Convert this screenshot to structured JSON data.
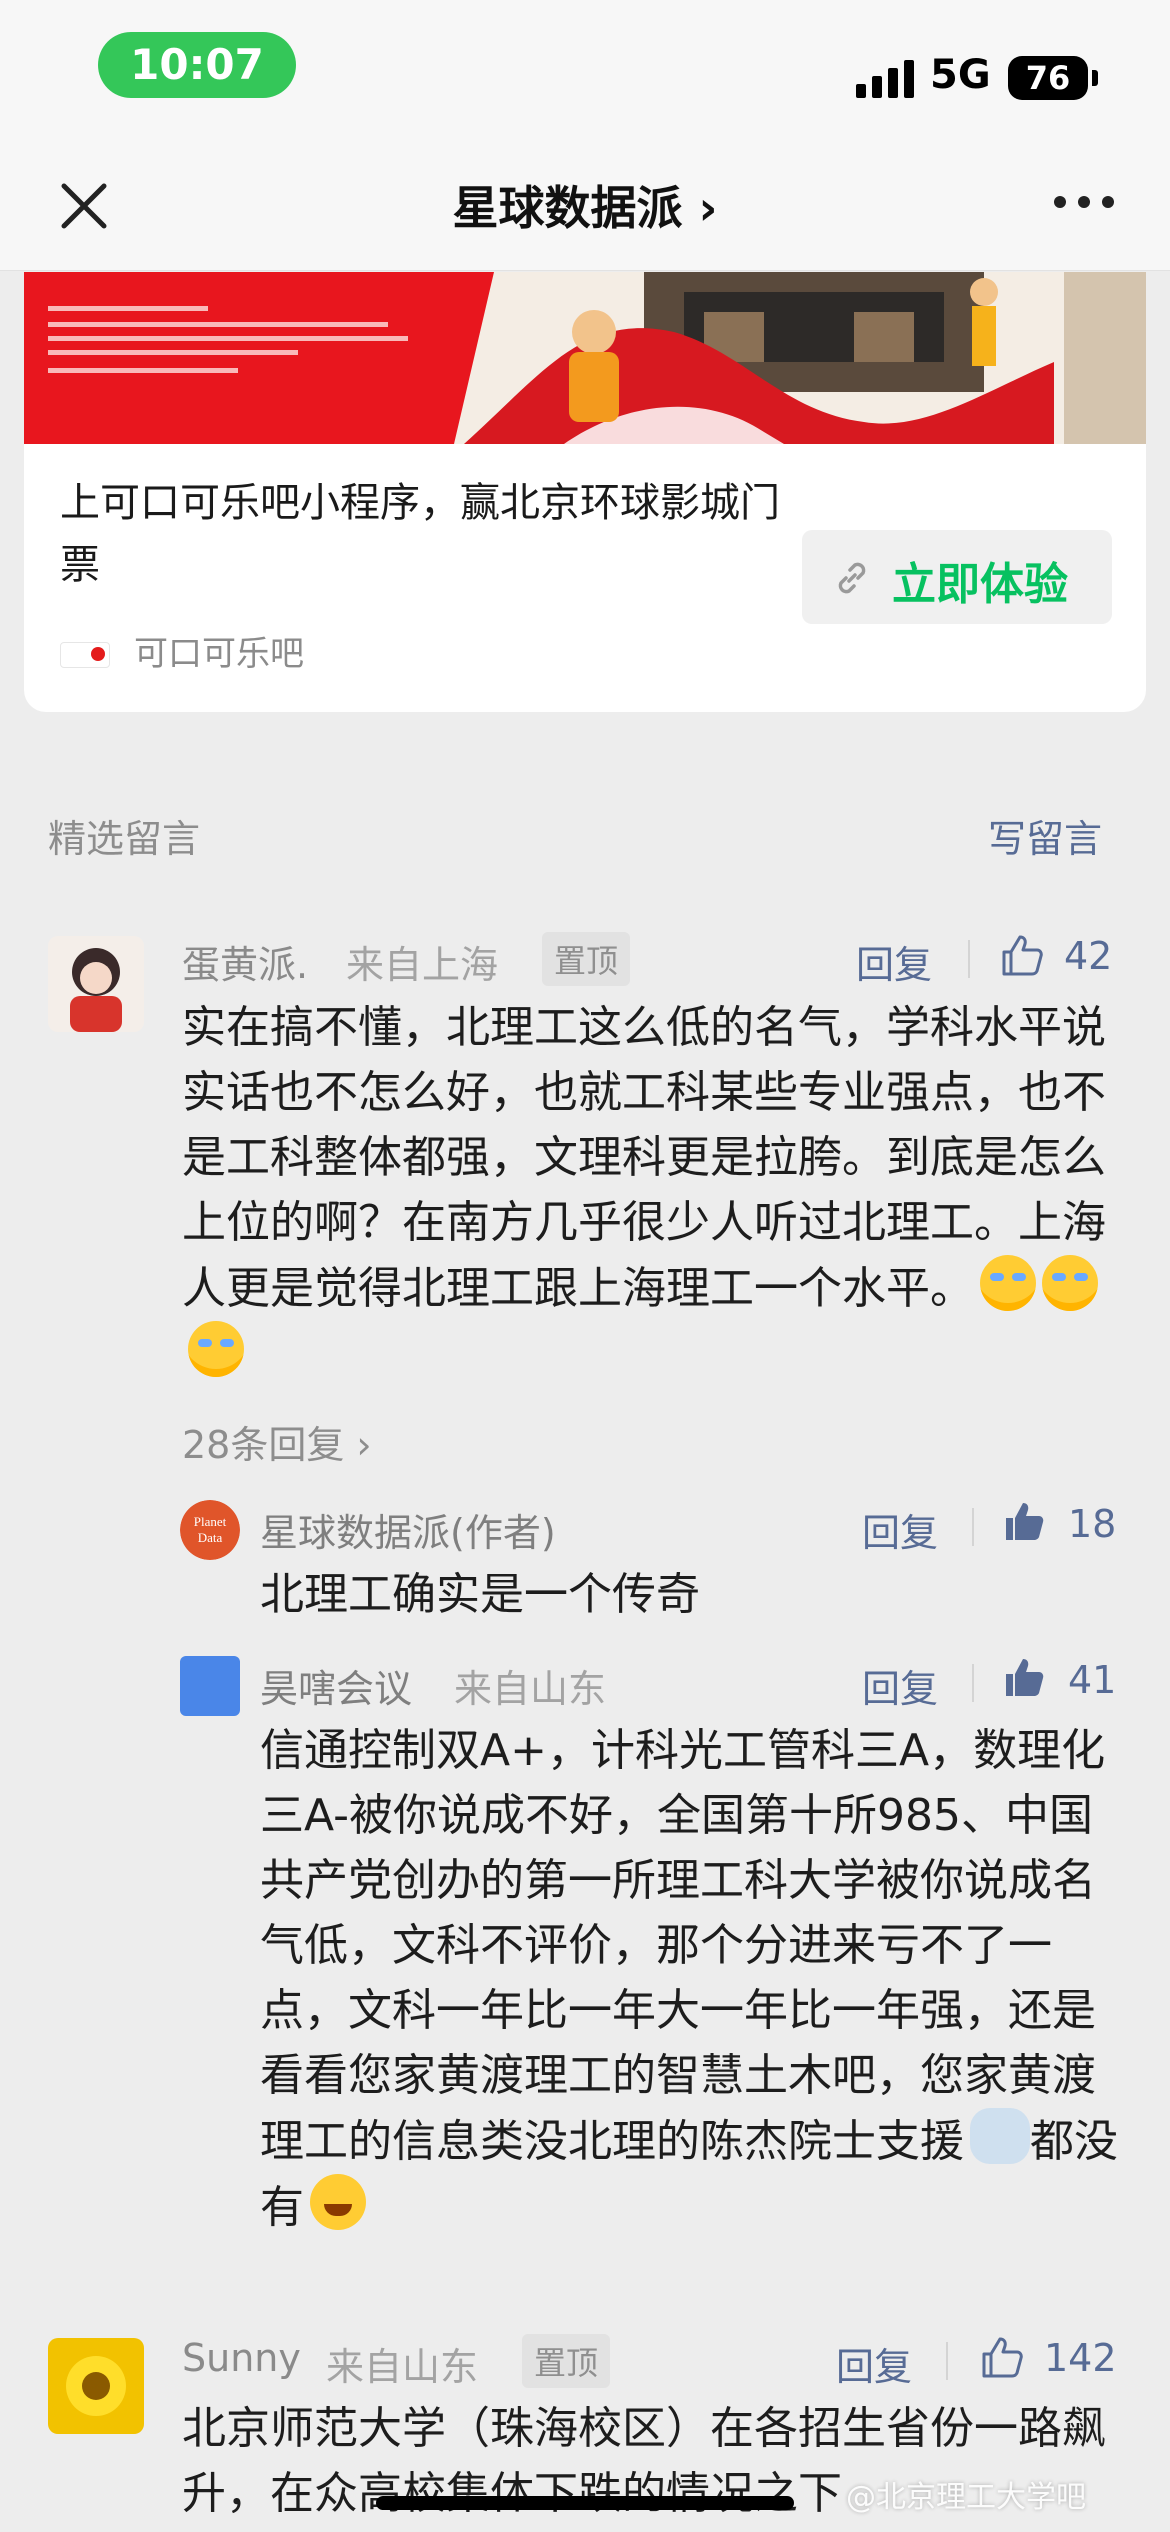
{
  "status_bar": {
    "time": "10:07",
    "network": "5G",
    "battery": "76"
  },
  "nav": {
    "title": "星球数据派 ›"
  },
  "ad": {
    "title": "上可口可乐吧小程序，赢北京环球影城门票",
    "cta_label": "立即体验",
    "source": "可口可乐吧"
  },
  "section": {
    "title": "精选留言",
    "write_label": "写留言"
  },
  "colors": {
    "link": "#576b95",
    "green": "#07c160",
    "pill": "#34c759"
  },
  "comments": [
    {
      "author": "蛋黄派.",
      "origin": "来自上海",
      "pinned": "置顶",
      "reply_label": "回复",
      "likes": "42",
      "text": "实在搞不懂，北理工这么低的名气，学科水平说实话也不怎么好，也就工科某些专业强点，也不是工科整体都强，文理科更是拉胯。到底是怎么上位的啊？在南方几乎很少人听过北理工。上海人更是觉得北理工跟上海理工一个水平。",
      "reply_count": "28条回复 ›",
      "replies": [
        {
          "author": "星球数据派(作者)",
          "reply_label": "回复",
          "likes": "18",
          "text": "北理工确实是一个传奇"
        },
        {
          "author": "昊嗐会议",
          "origin": "来自山东",
          "reply_label": "回复",
          "likes": "41",
          "text": "信通控制双A+，计科光工管科三A，数理化三A-被你说成不好，全国第十所985、中国共产党创办的第一所理工科大学被你说成名气低，文科不评价，那个分进来亏不了一点，文科一年比一年大一年比一年强，还是看看您家黄渡理工的智慧土木吧，您家黄渡理工的信息类没北理的陈杰院士支援",
          "text_tail": "都没有"
        }
      ]
    },
    {
      "author": "Sunny",
      "origin": "来自山东",
      "pinned": "置顶",
      "reply_label": "回复",
      "likes": "142",
      "text": "北京师范大学（珠海校区）在各招生省份一路飙升，在众高校集体下跌的情况之下"
    }
  ],
  "watermark": "@北京理工大学吧"
}
